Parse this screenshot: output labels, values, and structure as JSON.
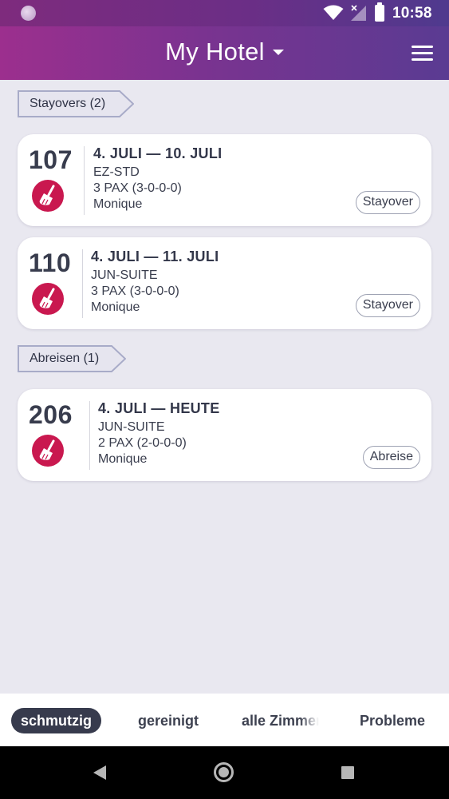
{
  "status_bar": {
    "time": "10:58"
  },
  "app_bar": {
    "title": "My Hotel"
  },
  "sections": [
    {
      "label": "Stayovers (2)",
      "rooms": [
        {
          "number": "107",
          "dates": "4. JULI — 10. JULI",
          "type": "EZ-STD",
          "pax": "3 PAX (3-0-0-0)",
          "staff": "Monique",
          "status": "Stayover"
        },
        {
          "number": "110",
          "dates": "4. JULI — 11. JULI",
          "type": "JUN-SUITE",
          "pax": "3 PAX (3-0-0-0)",
          "staff": "Monique",
          "status": "Stayover"
        }
      ]
    },
    {
      "label": "Abreisen (1)",
      "rooms": [
        {
          "number": "206",
          "dates": "4. JULI — HEUTE",
          "type": "JUN-SUITE",
          "pax": "2 PAX (2-0-0-0)",
          "staff": "Monique",
          "status": "Abreise"
        }
      ]
    }
  ],
  "tabs": [
    "schmutzig",
    "gereinigt",
    "alle Zimmer",
    "Probleme"
  ],
  "active_tab": 0,
  "colors": {
    "accent": "#c9184f",
    "appbar_start": "#9c2f8e",
    "appbar_end": "#5a3b92",
    "active_tab": "#373b4d"
  },
  "icons": {
    "room_state": "broom-icon",
    "menu": "hamburger-menu-icon",
    "dropdown": "caret-down-icon"
  }
}
